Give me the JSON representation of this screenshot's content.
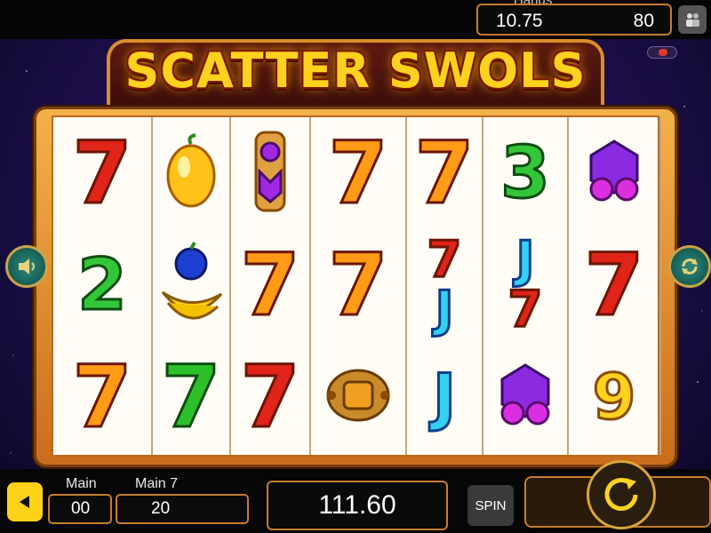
{
  "header": {
    "hands_label": "Hands",
    "credit_value": "10.75",
    "bet_value": "80"
  },
  "title": "SCATTER SWOLS",
  "reels": [
    [
      {
        "kind": "seven",
        "text": "7",
        "color": "red"
      },
      {
        "kind": "number",
        "text": "2",
        "color": "green"
      },
      {
        "kind": "seven",
        "text": "7",
        "color": "orange"
      }
    ],
    [
      {
        "kind": "icon",
        "icon": "lemon-icon"
      },
      {
        "kind": "icon",
        "icon": "plum-banana-icon"
      },
      {
        "kind": "seven",
        "text": "7",
        "color": "green"
      }
    ],
    [
      {
        "kind": "icon",
        "icon": "purple-totem-icon"
      },
      {
        "kind": "seven",
        "text": "7",
        "color": "orange"
      },
      {
        "kind": "seven",
        "text": "7",
        "color": "red"
      }
    ],
    [
      {
        "kind": "seven",
        "text": "7",
        "color": "orange"
      },
      {
        "kind": "seven",
        "text": "7",
        "color": "orange"
      },
      {
        "kind": "icon",
        "icon": "gold-amulet-icon"
      }
    ],
    [
      {
        "kind": "seven",
        "text": "7",
        "color": "orange"
      },
      {
        "kind": "stack",
        "items": [
          "7",
          "J"
        ]
      },
      {
        "kind": "letter",
        "text": "J"
      }
    ],
    [
      {
        "kind": "number",
        "text": "3",
        "color": "green"
      },
      {
        "kind": "stack",
        "items": [
          "J",
          "7"
        ]
      },
      {
        "kind": "icon",
        "icon": "purple-gem-icon"
      }
    ],
    [
      {
        "kind": "icon",
        "icon": "purple-gem-icon"
      },
      {
        "kind": "seven",
        "text": "7",
        "color": "red"
      },
      {
        "kind": "letter",
        "text": "9",
        "color": "yellow"
      }
    ]
  ],
  "bottom": {
    "main_label_1": "Main",
    "main_value_1": "00",
    "main_label_2": "Main 7",
    "main_value_2": "20",
    "win_value": "111.60",
    "spin_label": "SPIN"
  },
  "colors": {
    "frame": "#f3b24a",
    "title": "#ffd21f",
    "accent": "#c67c2e"
  }
}
